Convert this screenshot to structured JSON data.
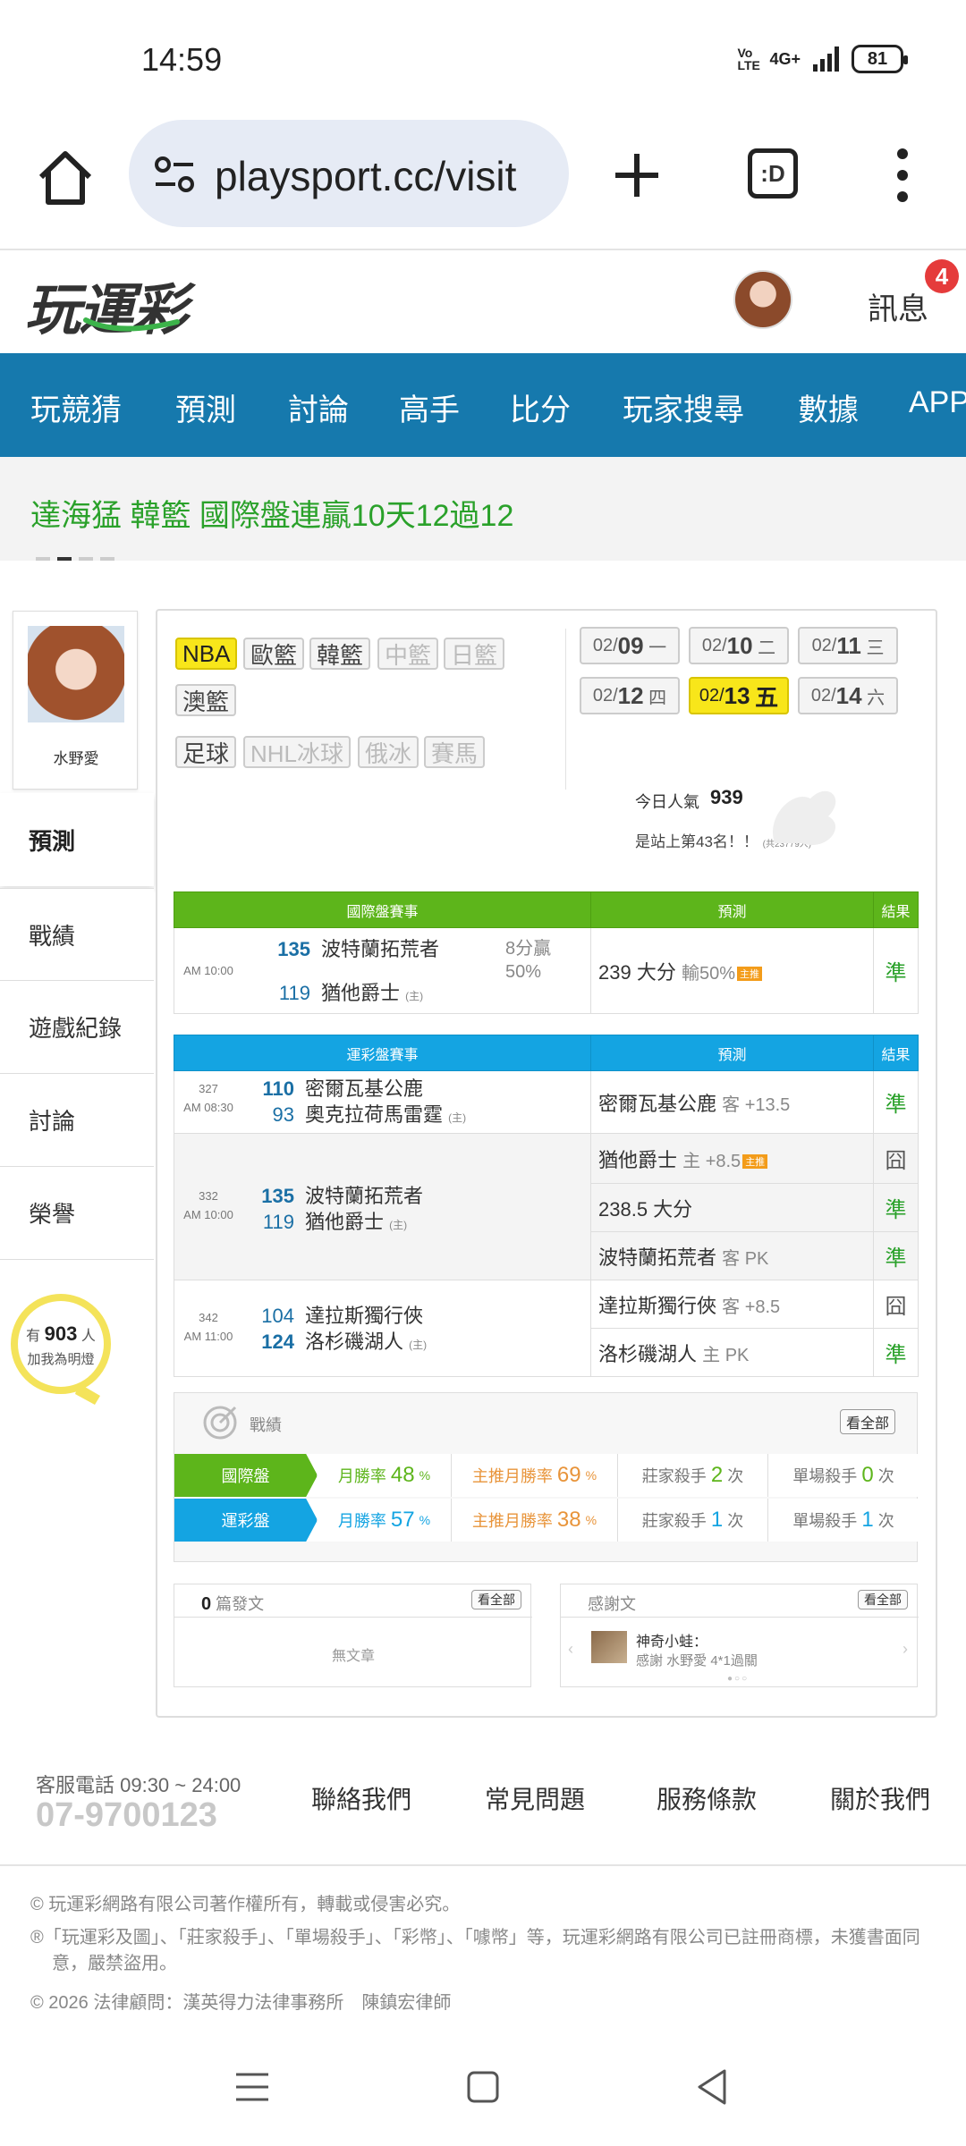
{
  "status": {
    "time": "14:59",
    "network": "4G+",
    "volte": "Vo LTE",
    "battery": "81"
  },
  "browser": {
    "url": "playsport.cc/visit",
    "tabs_label": ":D"
  },
  "header": {
    "logo": "玩運彩",
    "messages_label": "訊息",
    "messages_badge": "4"
  },
  "nav": {
    "items": [
      "玩競猜",
      "預測",
      "討論",
      "高手",
      "比分",
      "玩家搜尋",
      "數據",
      "APP"
    ]
  },
  "ticker": {
    "text": "達海猛 韓籃 國際盤連贏10天12過12"
  },
  "sidebar": {
    "name": "水野愛",
    "items": [
      "預測",
      "戰績",
      "遊戲紀錄",
      "討論",
      "榮譽"
    ],
    "fans_prefix": "有",
    "fans_count": "903",
    "fans_suffix": "人",
    "fans_caption": "加我為明燈"
  },
  "leagues": {
    "row1": [
      "NBA",
      "歐籃",
      "韓籃",
      "中籃",
      "日籃"
    ],
    "row2": [
      "澳籃"
    ],
    "row3": [
      "足球",
      "NHL冰球",
      "俄冰",
      "賽馬"
    ]
  },
  "dates": [
    {
      "md": "02/",
      "d": "09",
      "w": "一"
    },
    {
      "md": "02/",
      "d": "10",
      "w": "二"
    },
    {
      "md": "02/",
      "d": "11",
      "w": "三"
    },
    {
      "md": "02/",
      "d": "12",
      "w": "四"
    },
    {
      "md": "02/",
      "d": "13",
      "w": "五"
    },
    {
      "md": "02/",
      "d": "14",
      "w": "六"
    }
  ],
  "popularity": {
    "label": "今日人氣",
    "value": "939",
    "rank": "是站上第43名！！",
    "rank_total": "(共23779人)"
  },
  "intl_table": {
    "headers": [
      "國際盤賽事",
      "預測",
      "結果"
    ],
    "row": {
      "time": "AM 10:00",
      "away_num": "135",
      "away": "波特蘭拓荒者",
      "home_num": "119",
      "home": "猶他爵士",
      "host": "(主)",
      "line1": "8分贏",
      "line2": "50%",
      "pred": "239 大分",
      "pred_sub": "輸50%",
      "tag": "主推",
      "result": "準"
    }
  },
  "lottery_table": {
    "headers": [
      "運彩盤賽事",
      "預測",
      "結果"
    ],
    "games": [
      {
        "no": "327",
        "time": "AM 08:30",
        "away_num": "110",
        "away": "密爾瓦基公鹿",
        "home_num": "93",
        "home": "奧克拉荷馬雷霆",
        "host": "(主)"
      },
      {
        "no": "332",
        "time": "AM 10:00",
        "away_num": "135",
        "away": "波特蘭拓荒者",
        "home_num": "119",
        "home": "猶他爵士",
        "host": "(主)"
      },
      {
        "no": "342",
        "time": "AM 11:00",
        "away_num": "104",
        "away": "達拉斯獨行俠",
        "home_num": "124",
        "home": "洛杉磯湖人",
        "host": "(主)"
      }
    ],
    "preds": [
      {
        "main": "密爾瓦基公鹿",
        "sub": "客 +13.5",
        "tag": "",
        "result": "準"
      },
      {
        "main": "猶他爵士",
        "sub": "主 +8.5",
        "tag": "主推",
        "result": "囧"
      },
      {
        "main": "238.5 大分",
        "sub": "",
        "tag": "",
        "result": "準"
      },
      {
        "main": "波特蘭拓荒者",
        "sub": "客 PK",
        "tag": "",
        "result": "準"
      },
      {
        "main": "達拉斯獨行俠",
        "sub": "客 +8.5",
        "tag": "",
        "result": "囧"
      },
      {
        "main": "洛杉磯湖人",
        "sub": "主 PK",
        "tag": "",
        "result": "準"
      }
    ]
  },
  "record": {
    "title": "戰績",
    "view_all": "看全部",
    "rows": [
      {
        "name": "國際盤",
        "rate_label": "月勝率",
        "rate": "48",
        "rate_unit": "%",
        "main_label": "主推月勝率",
        "main": "69",
        "main_unit": "%",
        "k1_label": "莊家殺手",
        "k1": "2",
        "k1_unit": "次",
        "k2_label": "單場殺手",
        "k2": "0",
        "k2_unit": "次"
      },
      {
        "name": "運彩盤",
        "rate_label": "月勝率",
        "rate": "57",
        "rate_unit": "%",
        "main_label": "主推月勝率",
        "main": "38",
        "main_unit": "%",
        "k1_label": "莊家殺手",
        "k1": "1",
        "k1_unit": "次",
        "k2_label": "單場殺手",
        "k2": "1",
        "k2_unit": "次"
      }
    ]
  },
  "posts": {
    "count": "0",
    "count_label": "篇發文",
    "view_all": "看全部",
    "empty": "無文章"
  },
  "thanks": {
    "title": "感謝文",
    "view_all": "看全部",
    "author": "神奇小蛙：",
    "text": "感謝 水野愛 4*1過關"
  },
  "footer": {
    "service_label": "客服電話 09:30 ~ 24:00",
    "phone": "07-9700123",
    "links": [
      "聯絡我們",
      "常見問題",
      "服務條款",
      "關於我們"
    ],
    "copyright": "© 玩運彩網路有限公司著作權所有，轉載或侵害必究。",
    "trademark": "®「玩運彩及圖」、「莊家殺手」、「單場殺手」、「彩幣」、「噱幣」等，玩運彩網路有限公司已註冊商標，未獲書面同意，嚴禁盜用。",
    "legal": "© 2026 法律顧問：漢英得力法律事務所　陳鎮宏律師"
  },
  "colors": {
    "nav": "#1679ad",
    "green": "#5db51b",
    "blue": "#14a4e2",
    "highlight": "#f8e61a",
    "win": "#2aa12a"
  }
}
